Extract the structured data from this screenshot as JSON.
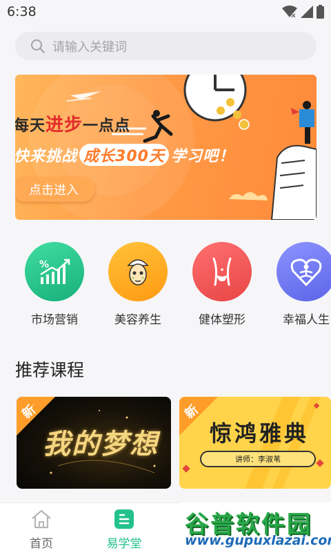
{
  "status_bar": {
    "time": "6:38"
  },
  "search": {
    "placeholder": "请输入关键词"
  },
  "banner": {
    "line1_a": "每天",
    "line1_hl": "进步",
    "line1_b": "一点点",
    "line2_a": "快来挑战",
    "line2_hl": "成长300天",
    "line2_b": "学习吧！",
    "button_label": "点击进入"
  },
  "categories": [
    {
      "label": "市场营销",
      "icon": "chart-up-icon",
      "color": "#22c28a"
    },
    {
      "label": "美容养生",
      "icon": "face-mask-icon",
      "color": "#ffa51f"
    },
    {
      "label": "健体塑形",
      "icon": "body-shape-icon",
      "color": "#f45a5a"
    },
    {
      "label": "幸福人生",
      "icon": "heart-meditation-icon",
      "color": "#6f78f0"
    }
  ],
  "recommend": {
    "title": "推荐课程",
    "badge": "新",
    "courses": [
      {
        "title": "我的梦想"
      },
      {
        "title": "惊鸿雅典",
        "teacher": "讲师：李淑苇"
      }
    ]
  },
  "tabs": [
    {
      "label": "首页",
      "icon": "home-icon",
      "active": false
    },
    {
      "label": "易学堂",
      "icon": "book-icon",
      "active": true
    }
  ],
  "watermark": {
    "title": "谷普软件园",
    "url": "www.gupuxlazai.com"
  },
  "colors": {
    "accent": "#22c28a",
    "banner": "#ff9a45"
  }
}
